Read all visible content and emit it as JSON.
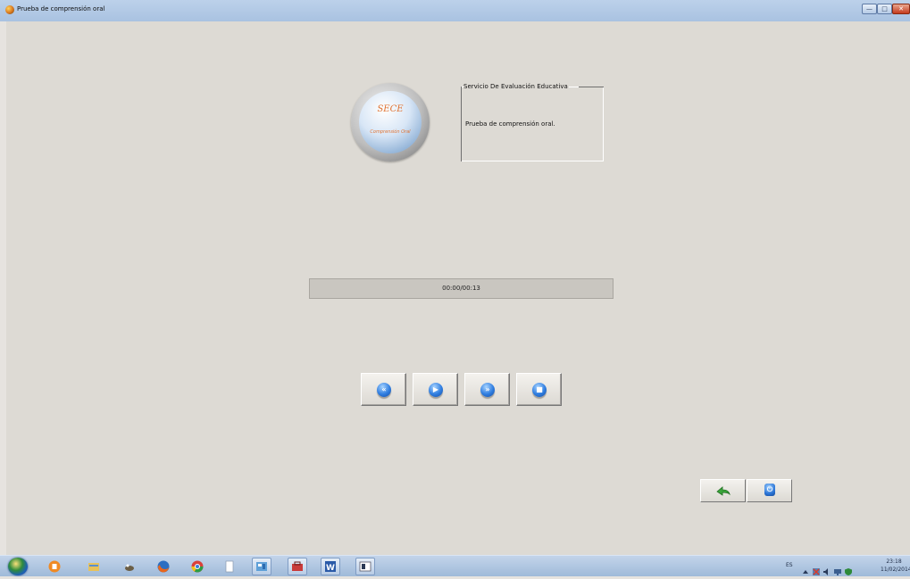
{
  "window": {
    "title": "Prueba de comprensión oral"
  },
  "logo": {
    "title": "SECE",
    "subtitle": "Comprensión Oral"
  },
  "info_panel": {
    "legend": "Servicio De Evaluación Educativa",
    "text": "Prueba de comprensión oral."
  },
  "player": {
    "time_display": "00:00/00:13",
    "progress_fraction": 0,
    "controls": [
      "rewind-icon",
      "play-icon",
      "fast-forward-icon",
      "stop-icon"
    ]
  },
  "actions": [
    "back-arrow-icon",
    "power-icon"
  ],
  "taskbar": {
    "apps": [
      "vlc-icon",
      "file-explorer-icon",
      "gimp-icon",
      "firefox-icon",
      "chrome-icon",
      "document-icon",
      "control-panel-icon",
      "toolbox-icon",
      "word-icon",
      "window-icon"
    ],
    "language": "ES",
    "time": "23:18",
    "date": "11/02/2014"
  },
  "colors": {
    "background": "#dddad4",
    "logo_text": "#e0712f",
    "button_icon_blue": "#2f7de0",
    "taskbar": "#a9c2e1"
  }
}
